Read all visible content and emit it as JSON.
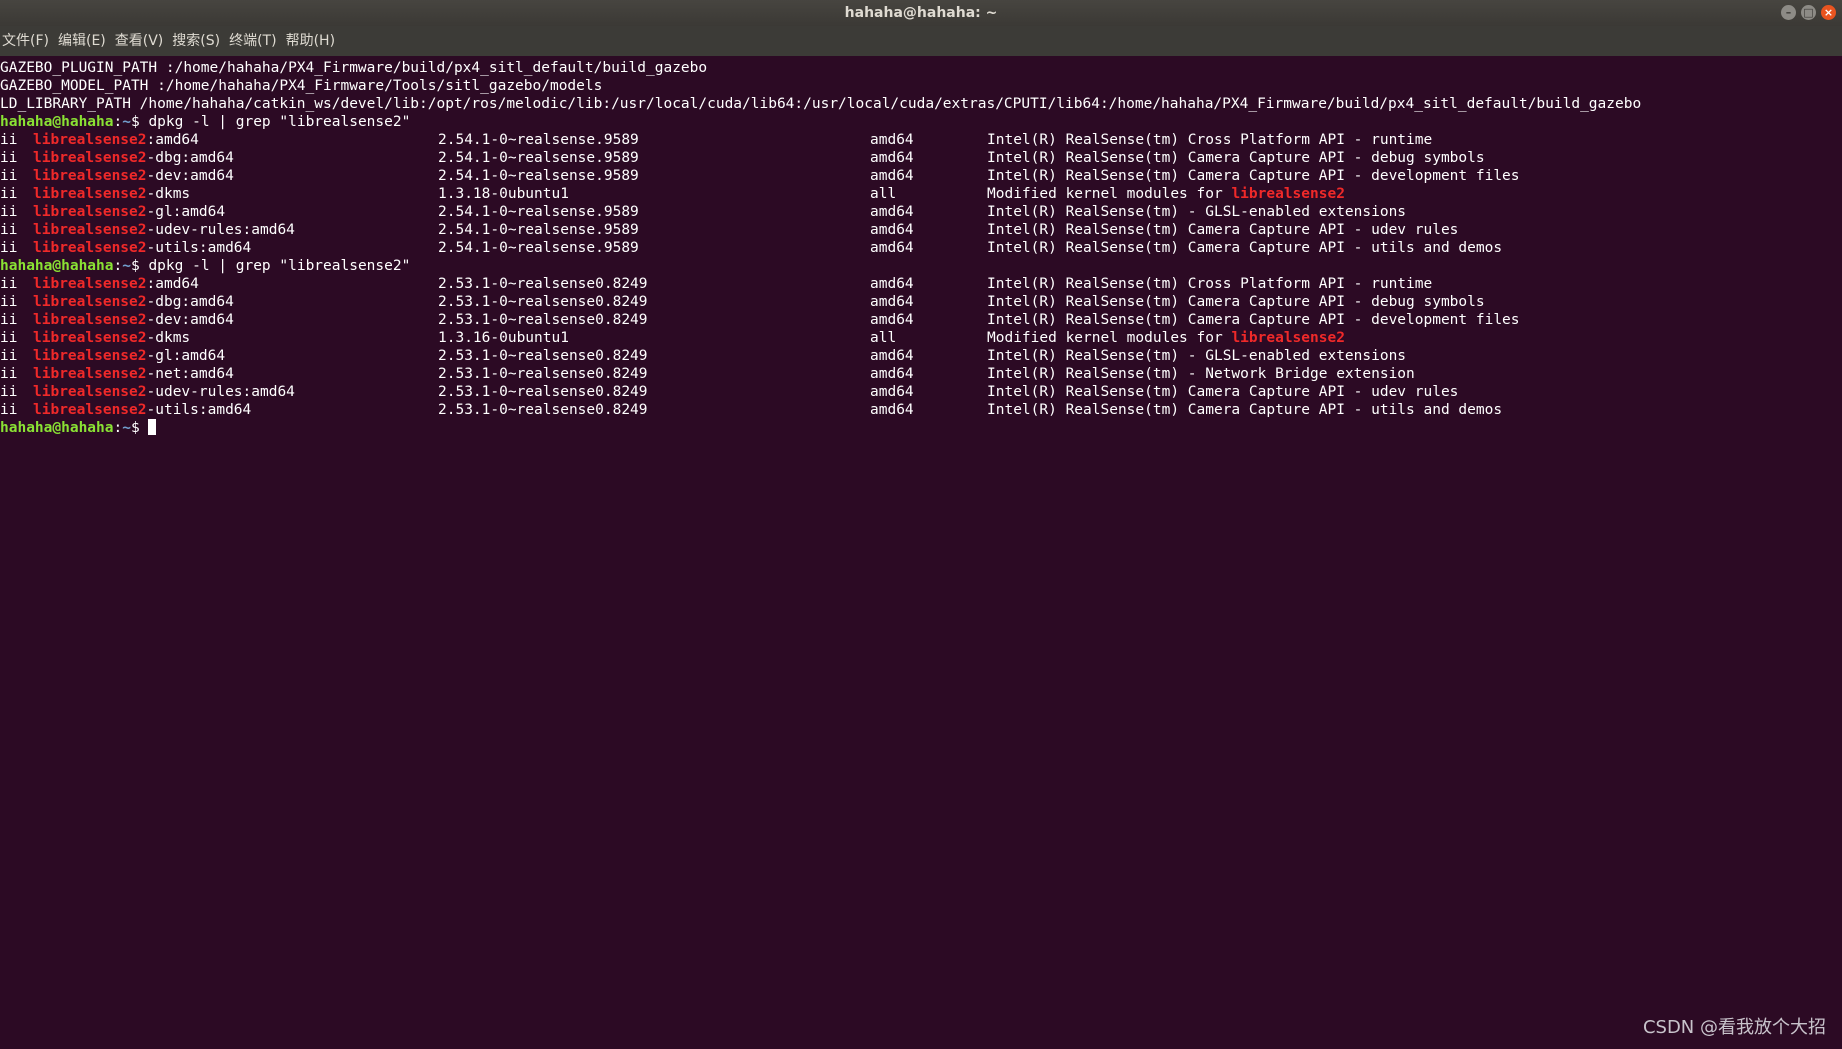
{
  "window": {
    "title": "hahaha@hahaha: ~",
    "controls": [
      {
        "icon": "minimize-icon",
        "glyph": "–"
      },
      {
        "icon": "maximize-icon",
        "glyph": "□"
      },
      {
        "icon": "close-icon",
        "glyph": "×"
      }
    ]
  },
  "menubar": [
    {
      "label": "文件(F)"
    },
    {
      "label": "编辑(E)"
    },
    {
      "label": "查看(V)"
    },
    {
      "label": "搜索(S)"
    },
    {
      "label": "终端(T)"
    },
    {
      "label": "帮助(H)"
    }
  ],
  "prompt": {
    "user": "hahaha@hahaha",
    "sep": ":",
    "path": "~",
    "symbol": "$ "
  },
  "colors": {
    "background": "#2c0a24",
    "text": "#ffffff",
    "highlight": "#ef2929",
    "prompt_user": "#8ae234",
    "prompt_path": "#729fcf"
  },
  "terminal": {
    "env_lines": [
      "GAZEBO_PLUGIN_PATH :/home/hahaha/PX4_Firmware/build/px4_sitl_default/build_gazebo",
      "GAZEBO_MODEL_PATH :/home/hahaha/PX4_Firmware/Tools/sitl_gazebo/models",
      "LD_LIBRARY_PATH /home/hahaha/catkin_ws/devel/lib:/opt/ros/melodic/lib:/usr/local/cuda/lib64:/usr/local/cuda/extras/CPUTI/lib64:/home/hahaha/PX4_Firmware/build/px4_sitl_default/build_gazebo"
    ],
    "blocks": [
      {
        "command": "dpkg -l | grep \"librealsense2\"",
        "rows": [
          {
            "status": "ii",
            "pkg": "librealsense2",
            "suffix": ":amd64",
            "version": "2.54.1-0~realsense.9589",
            "arch": "amd64",
            "desc": "Intel(R) RealSense(tm) Cross Platform API - runtime",
            "desc_hl": ""
          },
          {
            "status": "ii",
            "pkg": "librealsense2",
            "suffix": "-dbg:amd64",
            "version": "2.54.1-0~realsense.9589",
            "arch": "amd64",
            "desc": "Intel(R) RealSense(tm) Camera Capture API - debug symbols",
            "desc_hl": ""
          },
          {
            "status": "ii",
            "pkg": "librealsense2",
            "suffix": "-dev:amd64",
            "version": "2.54.1-0~realsense.9589",
            "arch": "amd64",
            "desc": "Intel(R) RealSense(tm) Camera Capture API - development files",
            "desc_hl": ""
          },
          {
            "status": "ii",
            "pkg": "librealsense2",
            "suffix": "-dkms",
            "version": "1.3.18-0ubuntu1",
            "arch": "all",
            "desc": "Modified kernel modules for ",
            "desc_hl": "librealsense2"
          },
          {
            "status": "ii",
            "pkg": "librealsense2",
            "suffix": "-gl:amd64",
            "version": "2.54.1-0~realsense.9589",
            "arch": "amd64",
            "desc": "Intel(R) RealSense(tm) - GLSL-enabled extensions",
            "desc_hl": ""
          },
          {
            "status": "ii",
            "pkg": "librealsense2",
            "suffix": "-udev-rules:amd64",
            "version": "2.54.1-0~realsense.9589",
            "arch": "amd64",
            "desc": "Intel(R) RealSense(tm) Camera Capture API - udev rules",
            "desc_hl": ""
          },
          {
            "status": "ii",
            "pkg": "librealsense2",
            "suffix": "-utils:amd64",
            "version": "2.54.1-0~realsense.9589",
            "arch": "amd64",
            "desc": "Intel(R) RealSense(tm) Camera Capture API - utils and demos",
            "desc_hl": ""
          }
        ]
      },
      {
        "command": "dpkg -l | grep \"librealsense2\"",
        "rows": [
          {
            "status": "ii",
            "pkg": "librealsense2",
            "suffix": ":amd64",
            "version": "2.53.1-0~realsense0.8249",
            "arch": "amd64",
            "desc": "Intel(R) RealSense(tm) Cross Platform API - runtime",
            "desc_hl": ""
          },
          {
            "status": "ii",
            "pkg": "librealsense2",
            "suffix": "-dbg:amd64",
            "version": "2.53.1-0~realsense0.8249",
            "arch": "amd64",
            "desc": "Intel(R) RealSense(tm) Camera Capture API - debug symbols",
            "desc_hl": ""
          },
          {
            "status": "ii",
            "pkg": "librealsense2",
            "suffix": "-dev:amd64",
            "version": "2.53.1-0~realsense0.8249",
            "arch": "amd64",
            "desc": "Intel(R) RealSense(tm) Camera Capture API - development files",
            "desc_hl": ""
          },
          {
            "status": "ii",
            "pkg": "librealsense2",
            "suffix": "-dkms",
            "version": "1.3.16-0ubuntu1",
            "arch": "all",
            "desc": "Modified kernel modules for ",
            "desc_hl": "librealsense2"
          },
          {
            "status": "ii",
            "pkg": "librealsense2",
            "suffix": "-gl:amd64",
            "version": "2.53.1-0~realsense0.8249",
            "arch": "amd64",
            "desc": "Intel(R) RealSense(tm) - GLSL-enabled extensions",
            "desc_hl": ""
          },
          {
            "status": "ii",
            "pkg": "librealsense2",
            "suffix": "-net:amd64",
            "version": "2.53.1-0~realsense0.8249",
            "arch": "amd64",
            "desc": "Intel(R) RealSense(tm) - Network Bridge extension",
            "desc_hl": ""
          },
          {
            "status": "ii",
            "pkg": "librealsense2",
            "suffix": "-udev-rules:amd64",
            "version": "2.53.1-0~realsense0.8249",
            "arch": "amd64",
            "desc": "Intel(R) RealSense(tm) Camera Capture API - udev rules",
            "desc_hl": ""
          },
          {
            "status": "ii",
            "pkg": "librealsense2",
            "suffix": "-utils:amd64",
            "version": "2.53.1-0~realsense0.8249",
            "arch": "amd64",
            "desc": "Intel(R) RealSense(tm) Camera Capture API - utils and demos",
            "desc_hl": ""
          }
        ]
      }
    ]
  },
  "watermark": "CSDN @看我放个大招"
}
